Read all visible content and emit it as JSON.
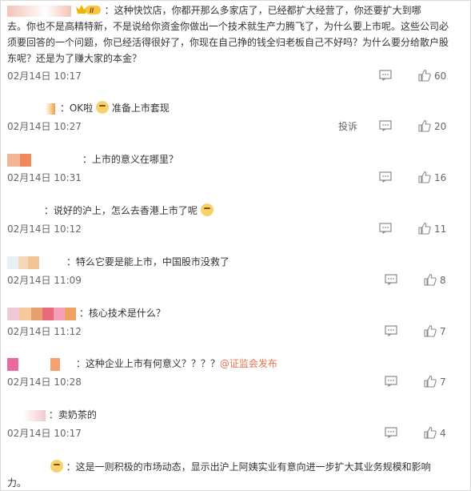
{
  "comments": [
    {
      "lines": [
        "：这种快饮店，你都开那么多家店了，已经都扩大经营了，你还要扩大到哪",
        "去。你也不是高精特新，不是说给你资金你做出一个技术就生产力腾飞了，为什么要上市呢。这些公司必",
        "须要回答的一个问题，你已经活得很好了，你现在自己挣的钱全归老板自己不好吗？为什么要分给散户股",
        "东呢？还是为了赚大家的本金？"
      ],
      "time": "02月14日 10:17",
      "likes": "60"
    },
    {
      "text": "：OK啦",
      "text2": "准备上市套现",
      "time": "02月14日 10:27",
      "report": "投诉",
      "likes": "20"
    },
    {
      "text": "：上市的意义在哪里？",
      "time": "02月14日 10:31",
      "likes": "16"
    },
    {
      "text": "：说好的沪上，怎么去香港上市了呢",
      "time": "02月14日 10:12",
      "likes": "11"
    },
    {
      "text": "：特么它要是能上市，中国股市没救了",
      "time": "02月14日 11:09",
      "likes": "8"
    },
    {
      "text": "：核心技术是什么？",
      "time": "02月14日 11:12",
      "likes": "7"
    },
    {
      "text": "：这种企业上市有何意义？？？？",
      "mention": "@证监会发布",
      "time": "02月14日 10:28",
      "likes": "7"
    },
    {
      "text": "：卖奶茶的",
      "time": "02月14日 10:17",
      "likes": "4"
    },
    {
      "lines": [
        "：这是一则积极的市场动态，显示出沪上阿姨实业有意向进一步扩大其业务规模和影响",
        "力。"
      ]
    }
  ],
  "icons": {
    "reply": "comment-icon",
    "like": "thumbs-up-icon",
    "vip": "crown-badge-icon",
    "emoji": "doge-emoji-icon"
  },
  "colors": {
    "mention": "#eb7350",
    "text": "#333333",
    "meta": "#666666"
  }
}
